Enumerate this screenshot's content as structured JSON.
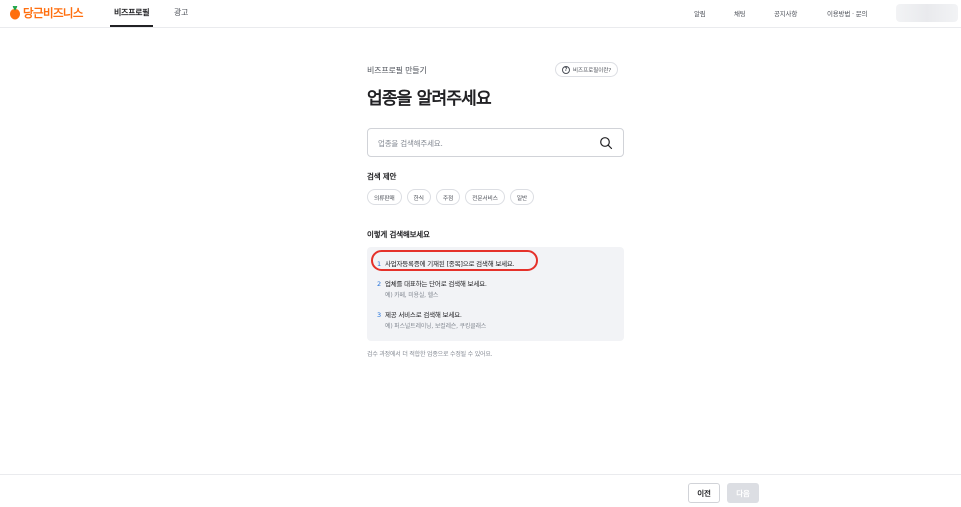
{
  "header": {
    "logo_text": "당근비즈니스",
    "tabs": [
      {
        "label": "비즈프로필",
        "active": true
      },
      {
        "label": "광고",
        "active": false
      }
    ],
    "links": [
      "알림",
      "채팅",
      "공지사항",
      "이용방법 · 문의"
    ],
    "brand_color": "#ff6f0f"
  },
  "main": {
    "breadcrumb": "비즈프로필 만들기",
    "help_button": "비즈프로필이란?",
    "title": "업종을 알려주세요",
    "search": {
      "placeholder": "업종을 검색해주세요."
    },
    "suggest_label": "검색 제안",
    "suggestions": [
      "의류판매",
      "한식",
      "주점",
      "전문서비스",
      "일반"
    ],
    "tips_label": "이렇게 검색해보세요",
    "tips": [
      {
        "num": "1",
        "text": "사업자등록증에 기재된 [종목]으로 검색해 보세요.",
        "sub": ""
      },
      {
        "num": "2",
        "text": "업체를 대표하는 단어로 검색해 보세요.",
        "sub": "예) 카페, 미용실, 헬스"
      },
      {
        "num": "3",
        "text": "제공 서비스로 검색해 보세요.",
        "sub": "예) 퍼스널트레이닝, 보컬레슨, 쿠킹클래스"
      }
    ],
    "footnote": "검수 과정에서 더 적합한 업종으로 수정될 수 있어요.",
    "highlight_color": "#e5312a"
  },
  "footer": {
    "prev_label": "이전",
    "next_label": "다음"
  }
}
